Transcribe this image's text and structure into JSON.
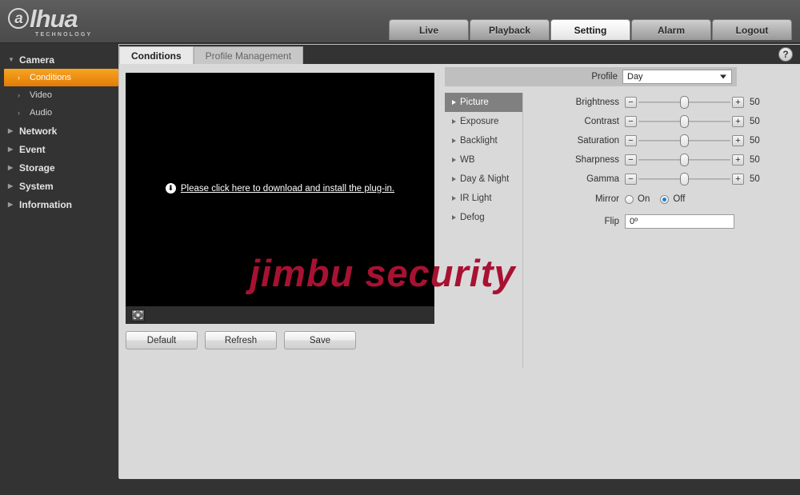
{
  "brand": {
    "logo_a": "a",
    "logo_text": "lhua",
    "logo_sub": "TECHNOLOGY"
  },
  "nav": {
    "tabs": [
      {
        "label": "Live",
        "active": false
      },
      {
        "label": "Playback",
        "active": false
      },
      {
        "label": "Setting",
        "active": true
      },
      {
        "label": "Alarm",
        "active": false
      },
      {
        "label": "Logout",
        "active": false
      }
    ]
  },
  "sidebar": {
    "items": [
      {
        "label": "Camera",
        "type": "group",
        "expanded": true
      },
      {
        "label": "Conditions",
        "type": "sub",
        "active": true
      },
      {
        "label": "Video",
        "type": "sub",
        "active": false
      },
      {
        "label": "Audio",
        "type": "sub",
        "active": false
      },
      {
        "label": "Network",
        "type": "group",
        "expanded": false
      },
      {
        "label": "Event",
        "type": "group",
        "expanded": false
      },
      {
        "label": "Storage",
        "type": "group",
        "expanded": false
      },
      {
        "label": "System",
        "type": "group",
        "expanded": false
      },
      {
        "label": "Information",
        "type": "group",
        "expanded": false
      }
    ]
  },
  "content_tabs": [
    {
      "label": "Conditions",
      "active": true
    },
    {
      "label": "Profile Management",
      "active": false
    }
  ],
  "help_icon": "?",
  "video": {
    "plugin_message": "Please click here to download and install the plug-in.",
    "download_icon": "↓",
    "fullscreen_icon": "fullscreen-icon"
  },
  "buttons": {
    "default": "Default",
    "refresh": "Refresh",
    "save": "Save"
  },
  "profile": {
    "label": "Profile",
    "value": "Day"
  },
  "submenu": [
    {
      "label": "Picture",
      "active": true
    },
    {
      "label": "Exposure",
      "active": false
    },
    {
      "label": "Backlight",
      "active": false
    },
    {
      "label": "WB",
      "active": false
    },
    {
      "label": "Day & Night",
      "active": false
    },
    {
      "label": "IR Light",
      "active": false
    },
    {
      "label": "Defog",
      "active": false
    }
  ],
  "sliders": [
    {
      "label": "Brightness",
      "value": "50",
      "percent": 50,
      "minus": "−",
      "plus": "+"
    },
    {
      "label": "Contrast",
      "value": "50",
      "percent": 50,
      "minus": "−",
      "plus": "+"
    },
    {
      "label": "Saturation",
      "value": "50",
      "percent": 50,
      "minus": "−",
      "plus": "+"
    },
    {
      "label": "Sharpness",
      "value": "50",
      "percent": 50,
      "minus": "−",
      "plus": "+"
    },
    {
      "label": "Gamma",
      "value": "50",
      "percent": 50,
      "minus": "−",
      "plus": "+"
    }
  ],
  "mirror": {
    "label": "Mirror",
    "on_label": "On",
    "off_label": "Off",
    "selected": "Off"
  },
  "flip": {
    "label": "Flip",
    "value": "0º"
  },
  "watermark": "jimbu security",
  "colors": {
    "accent_orange": "#ef8f13",
    "header_gray": "#545454",
    "panel_gray": "#d9d9d9",
    "page_dark": "#333333",
    "watermark_red": "#a81232",
    "radio_blue": "#1e7fd6"
  }
}
